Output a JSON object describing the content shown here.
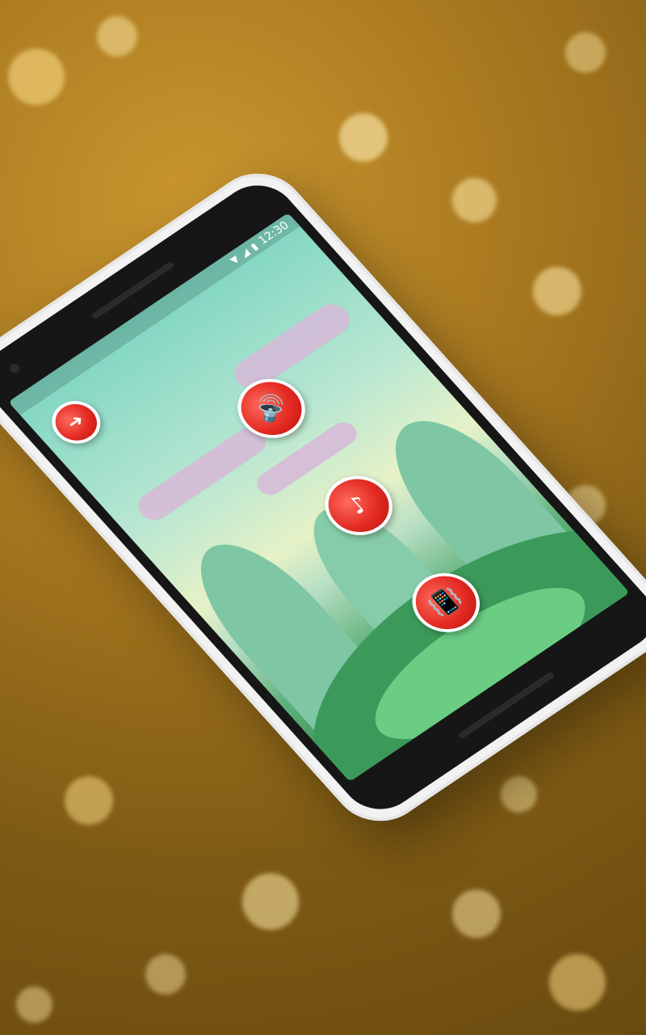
{
  "status_bar": {
    "time": "12:30",
    "icons": [
      "wifi-icon",
      "signal-icon",
      "battery-icon"
    ]
  },
  "buttons": {
    "back_icon": "back-arrow-icon",
    "sound_icon": "speaker-volume-icon",
    "music_icon": "music-note-icon",
    "vibrate_icon": "vibrate-phone-icon"
  },
  "colors": {
    "button_red": "#e32a22",
    "background_gold": "#b58227",
    "phone_body": "#f2f2f2"
  }
}
